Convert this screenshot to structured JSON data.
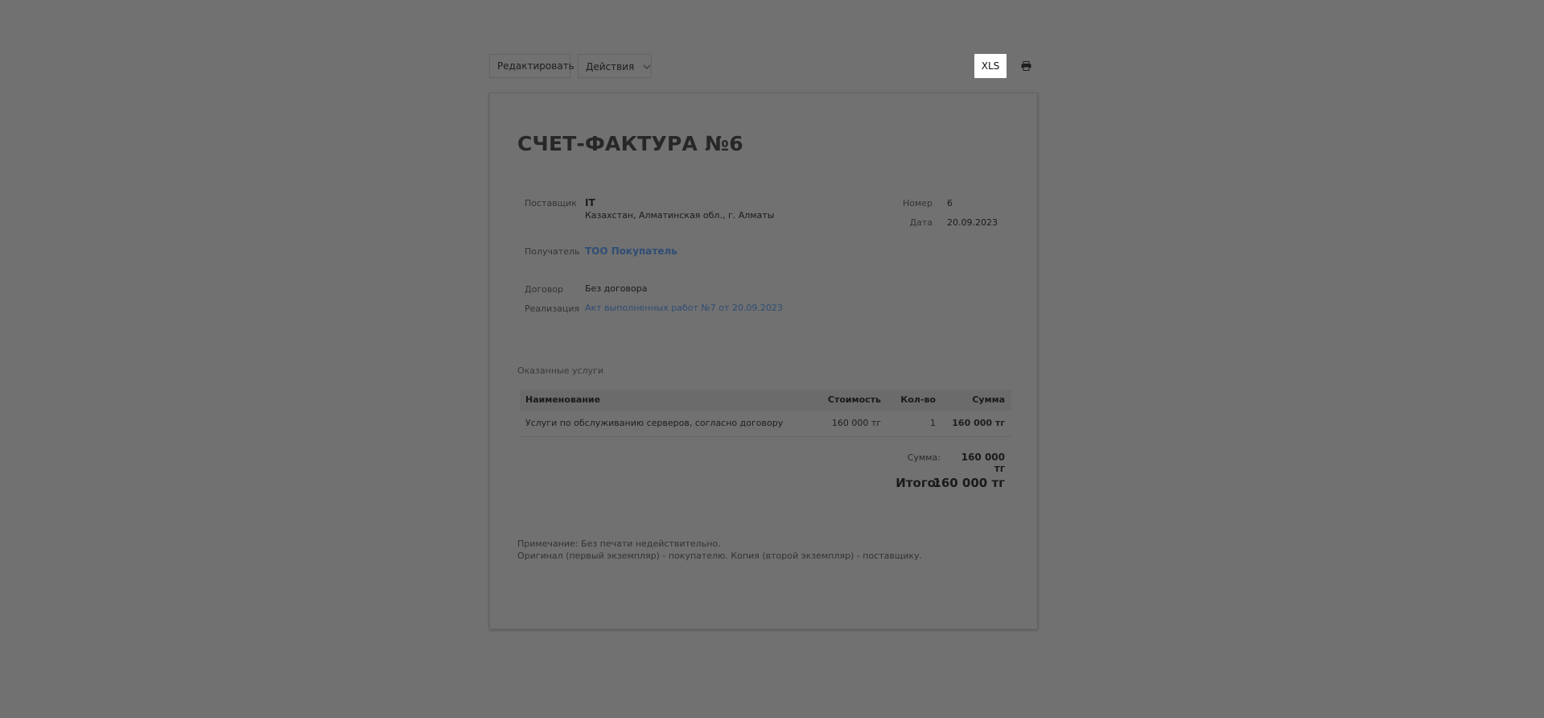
{
  "toolbar": {
    "edit_label": "Редактировать",
    "actions_label": "Действия",
    "xls_label": "XLS",
    "print_icon": "printer-icon"
  },
  "document": {
    "title": "СЧЕТ-ФАКТУРА №6",
    "supplier": {
      "label": "Поставщик",
      "name": "IT",
      "address": "Казахстан, Алматинская обл., г. Алматы"
    },
    "number": {
      "label": "Номер",
      "value": "6"
    },
    "date": {
      "label": "Дата",
      "value": "20.09.2023"
    },
    "recipient": {
      "label": "Получатель",
      "name": "ТОО Покупатель"
    },
    "contract": {
      "label": "Договор",
      "value": "Без договора"
    },
    "realization": {
      "label": "Реализация",
      "value": "Акт выполненных работ №7 от 20.09.2023"
    },
    "services_caption": "Оказанные услуги",
    "table": {
      "headers": {
        "name": "Наименование",
        "cost": "Стоимость",
        "qty": "Кол-во",
        "sum": "Сумма"
      },
      "rows": [
        {
          "name": "Услуги по обслуживанию серверов, согласно договору",
          "cost": "160 000 тг",
          "qty": "1",
          "sum": "160 000 тг"
        }
      ]
    },
    "sum_label": "Сумма:",
    "sum_value": "160 000 тг",
    "total_label": "Итого:",
    "total_value": "160 000 тг",
    "note_line1": "Примечание: Без печати недействительно.",
    "note_line2": "Оригинал (первый экземпляр) - покупателю. Копия (второй экземпляр) - поставщику."
  },
  "colors": {
    "backdrop": "#717171",
    "link": "#2f4d74",
    "highlight_button": "#ffffff"
  }
}
